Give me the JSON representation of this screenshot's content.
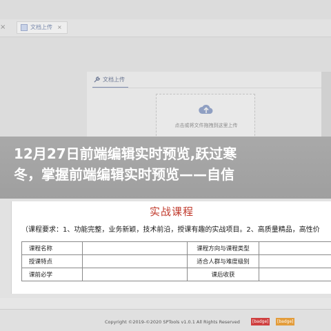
{
  "app": {
    "tab": {
      "label": "文档上传",
      "close": "×"
    },
    "left_close": "×",
    "panel": {
      "title": "文档上传",
      "upload_hint": "点击或将文件拖拽到这里上传"
    }
  },
  "banner": {
    "line1": "12月27日前端编辑实时预览,跃过寒",
    "line2": "冬，掌握前端编辑实时预览——自信"
  },
  "document": {
    "title": "实战课程",
    "requirements": "（课程要求：1、功能完整，业务新颖，技术前沿，授课有趣的实战项目。2、高质量精品，高性价",
    "rows": [
      [
        "课程名称",
        "",
        "课程方向与课程类型",
        ""
      ],
      [
        "授课特点",
        "",
        "适合人群与难度级别",
        ""
      ],
      [
        "课前必学",
        "",
        "课后收获",
        ""
      ]
    ]
  },
  "footer": {
    "copyright": "Copyright ©2019-©2020 SPTools v1.0.1 All Rights Reserved",
    "badge1": "[badge]",
    "badge2": "[badge]"
  },
  "colors": {
    "doc_title": "#c0392b",
    "accent": "#7a8aac",
    "banner": "#a6a6a6"
  }
}
